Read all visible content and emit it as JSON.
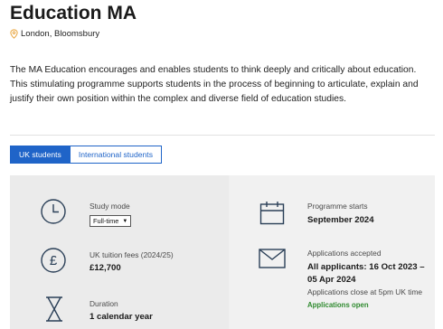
{
  "course": {
    "title": "Education MA",
    "location": "London, Bloomsbury",
    "description": "The MA Education encourages and enables students to think deeply and critically about education. This stimulating programme supports students in the process of beginning to articulate, explain and justify their own position within the complex and diverse field of education studies."
  },
  "tabs": [
    {
      "label": "UK students",
      "active": true
    },
    {
      "label": "International students",
      "active": false
    }
  ],
  "study_mode": {
    "label": "Study mode",
    "selected": "Full-time"
  },
  "fees": {
    "label": "UK tuition fees (2024/25)",
    "value": "£12,700"
  },
  "duration": {
    "label": "Duration",
    "value": "1 calendar year"
  },
  "programme_starts": {
    "label": "Programme starts",
    "value": "September 2024"
  },
  "applications": {
    "label": "Applications accepted",
    "value_line1": "All applicants: 16 Oct 2023 –",
    "value_line2": "05 Apr 2024",
    "note": "Applications close at 5pm UK time",
    "status": "Applications open"
  },
  "colors": {
    "accent": "#1f64c8",
    "location_pin": "#e8a33a",
    "status_open": "#2f8a2f",
    "icon": "#2a3f57"
  }
}
